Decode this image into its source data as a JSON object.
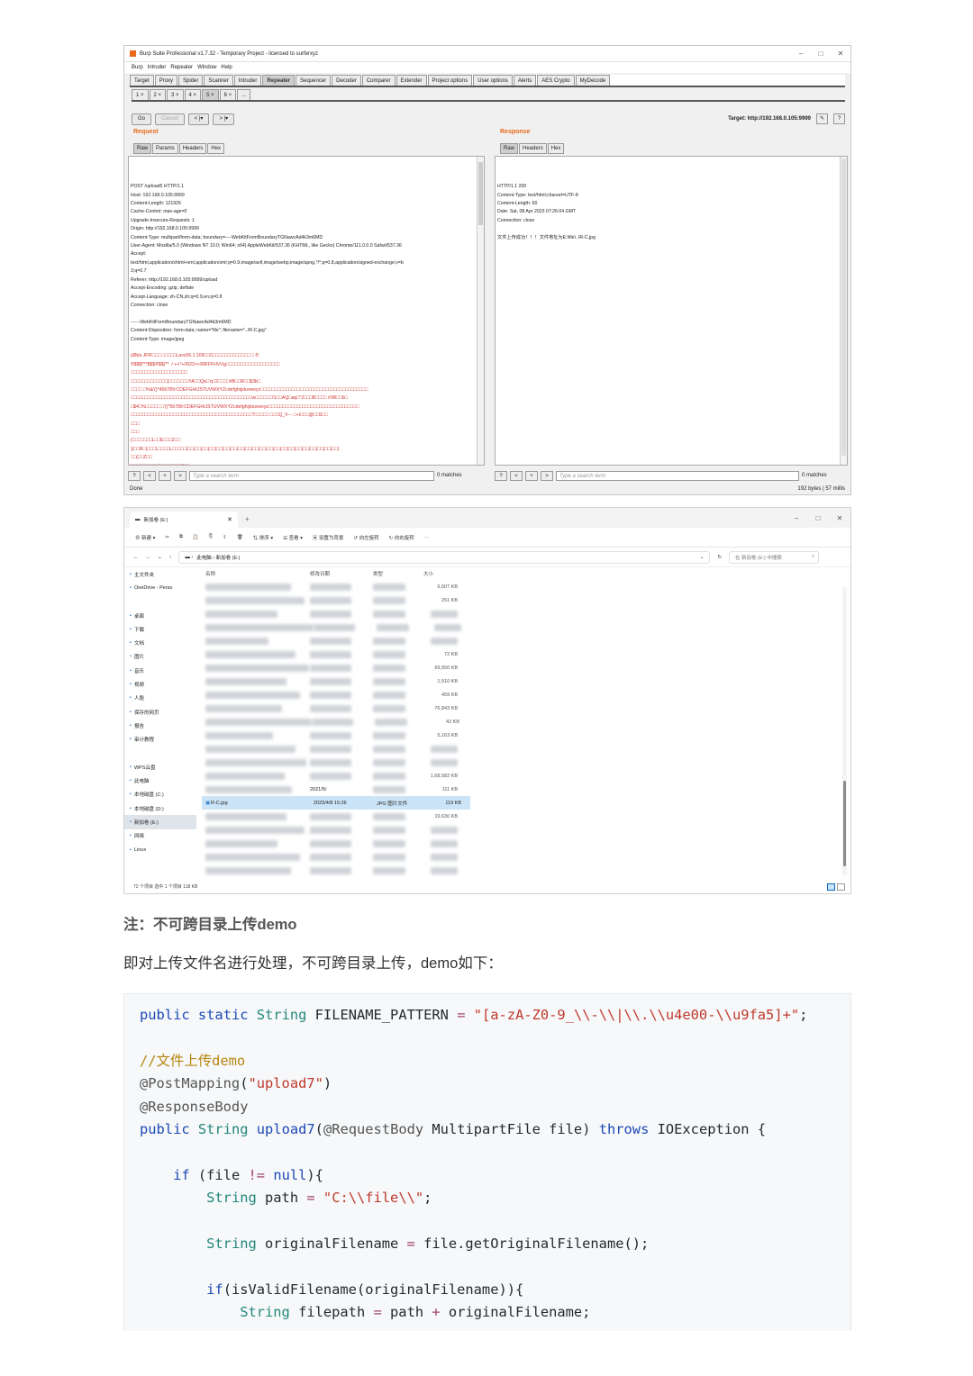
{
  "burp": {
    "title": "Burp Suite Professional v1.7.32 - Temporary Project - licensed to surferxyz",
    "menu": [
      "Burp",
      "Intruder",
      "Repeater",
      "Window",
      "Help"
    ],
    "tabs": [
      "Target",
      "Proxy",
      "Spider",
      "Scanner",
      "Intruder",
      "Repeater",
      "Sequencer",
      "Decoder",
      "Comparer",
      "Extender",
      "Project options",
      "User options",
      "Alerts",
      "AES Crypto",
      "MyDecode"
    ],
    "active_tab": "Repeater",
    "subtabs": [
      "1 ×",
      "2 ×",
      "3 ×",
      "4 ×",
      "5 ×",
      "6 ×",
      "..."
    ],
    "go": "Go",
    "cancel": "Cancel",
    "back": "< |▾",
    "fwd": "> |▾",
    "target": "Target: http://192.168.0.105:9999",
    "request_title": "Request",
    "request_tabs": [
      "Raw",
      "Params",
      "Headers",
      "Hex"
    ],
    "request_lines": [
      "POST /upload5 HTTP/1.1",
      "Host: 192.168.0.105:9999",
      "Content-Length: 121926",
      "Cache-Control: max-age=0",
      "Upgrade-Insecure-Requests: 1",
      "Origin: http://192.168.0.105:9999",
      "Content-Type: multipart/form-data; boundary=----WebKitFormBoundaryTGNawcAd4k3m6MD",
      "User-Agent: Mozilla/5.0 (Windows NT 10.0; Win64; x64) AppleWebKit/537.36 (KHTML, like Gecko) Chrome/111.0.0.0 Safari/537.36",
      "Accept:",
      "text/html,application/xhtml+xml,application/xml;q=0.9,image/avif,image/webp,image/apng,*/*;q=0.8,application/signed-exchange;v=b",
      "3;q=0.7",
      "Referer: http://192.168.0.105:9999/upload",
      "Accept-Encoding: gzip, deflate",
      "Accept-Language: zh-CN,zh;q=0.9,en;q=0.8",
      "Connection: close",
      "",
      "------WebKitFormBoundaryTGNawcAd4k3m6MD",
      "Content-Disposition: form-data; name=\"file\"; filename=\"../R-C.jpg\"",
      "Content-Type: image/jpeg",
      ""
    ],
    "request_binary": [
      "ÿØÿà JFIF□□□ □□□□□Lavc56.1.100□□C□□□□□□□□□□□□□ □ ®",
      "®$$$***$$$®$$(**  / ++*+//022<<99FFFHVVg□□□□□□□□□□□□□□□□□□□",
      "□□□□□□□□□□□□□□□□□□□□",
      "□□□□□□□□□□□□□)□□□□□□□!!A□□Qa□'q□2□□□□#B□□R□□$3b□",
      "□□□□ □%&'()*456789:CDEFGHIJSTUVWXYZcdefghijstuvwxyz□□□□□□□□□□□□□□□□□□□□□□□□□□□□□□□□□□□□□□",
      "□□□□□□□□□□□□□□□□□□□□□□□□□□□□□□□□□□□□□□□□□□□w□□□□□□!1□□AQ□aq□\"2□□□B□□□□ #3R□□b□",
      "□$4□%□□□□□ □'()*56789:CDEFGHIJSTUVWXYZcdefghijstuvwxyz□□□□□□□□□□□□□□□□□□□□□□□□□□□□□□□□",
      "□□□□□□□□□□□□□□□□□□□□□□□□□□□□□□□□□□□□□□□□□□□?□□□□□ □□□Q_V--- □÷t□□□@□□5□□",
      "□□□",
      "□□□",
      "(□□□□□□□L□□E□□□Z□□",
      ")(□□R□(□□□L□□□□L□□□□□(□□(□□(□□(□□(□□(□□(□□(□□(□□(□□(□□(□□(□□(□□(□□(□□(□□(□□(□□(□□(□□(",
      "□□(□□Z□□",
      ")(□□□□□□□□□)□□(□□(□□Z□□",
      ")(□□□□(□□(□□(□□(□□(□□E□□",
      "□□□□E□□□E□□q□□□□E□□",
      "□□□"
    ],
    "response_title": "Response",
    "response_tabs": [
      "Raw",
      "Headers",
      "Hex"
    ],
    "response_lines": [
      "HTTP/1.1 200",
      "Content-Type: text/html;charset=UTF-8",
      "Content-Length: 60",
      "Date: Sat, 08 Apr 2023 07:26:04 GMT",
      "Connection: close",
      ""
    ],
    "response_body": "文件上传成功！！！文件地址为E:\\file\\..\\R-C.jpg",
    "search_placeholder": "Type a search term",
    "matches_left": "0 matches",
    "matches_right": "0 matches",
    "status_left": "Done",
    "status_right": "192 bytes | 57 millis"
  },
  "explorer": {
    "tab_title": "新加卷 (E:)",
    "cmd": [
      "新建",
      "排序",
      "查看",
      "设置为背景",
      "向左旋转",
      "向右旋转",
      "···"
    ],
    "breadcrumb": "此电脑  ›  新加卷 (E:)",
    "search_placeholder": "在 新加卷 (E:) 中搜索",
    "columns": [
      "名称",
      "修改日期",
      "类型",
      "大小"
    ],
    "nav": [
      {
        "label": "主文件夹",
        "icon": "home-icon"
      },
      {
        "label": "OneDrive - Perso",
        "icon": "cloud-icon"
      },
      {
        "label": "",
        "icon": ""
      },
      {
        "label": "桌面",
        "icon": "desktop-icon"
      },
      {
        "label": "下载",
        "icon": "download-icon"
      },
      {
        "label": "文档",
        "icon": "document-icon"
      },
      {
        "label": "图片",
        "icon": "picture-icon"
      },
      {
        "label": "音乐",
        "icon": "music-icon"
      },
      {
        "label": "视频",
        "icon": "video-icon"
      },
      {
        "label": "人脸",
        "icon": "folder-icon"
      },
      {
        "label": "保存的网页",
        "icon": "folder-icon"
      },
      {
        "label": "报告",
        "icon": "folder-icon"
      },
      {
        "label": "审计教程",
        "icon": "folder-icon"
      },
      {
        "label": "",
        "icon": ""
      },
      {
        "label": "WPS云盘",
        "icon": "cloud-icon"
      },
      {
        "label": "此电脑",
        "icon": "pc-icon"
      },
      {
        "label": "本地磁盘 (C:)",
        "icon": "drive-icon"
      },
      {
        "label": "本地磁盘 (D:)",
        "icon": "drive-icon"
      },
      {
        "label": "新加卷 (E:)",
        "icon": "drive-icon"
      },
      {
        "label": "网络",
        "icon": "network-icon"
      },
      {
        "label": "Linux",
        "icon": "linux-icon"
      }
    ],
    "sizes": [
      "6,507 KB",
      "251 KB",
      "",
      "",
      "",
      "72 KB",
      "69,550 KB",
      "1,510 KB",
      "459 KB",
      "76,843 KB",
      "42 KB",
      "5,163 KB",
      "",
      "",
      "1,68,582 KB",
      "111 KB",
      "119 KB",
      "19,630 KB",
      "",
      "",
      "",
      ""
    ],
    "highlight_row": {
      "name": "R-C.jpg",
      "date": "2023/4/8 15:26",
      "type": "JPG 图片文件",
      "size": "119 KB"
    },
    "row_2021": "2021/5/",
    "status": "72 个项目    选中 1 个项目  118 KB"
  },
  "note": "注：不可跨目录上传demo",
  "paragraph": "即对上传文件名进行处理，不可跨目录上传，demo如下：",
  "code_lines": [
    "public static String FILENAME_PATTERN = \"[a-zA-Z0-9_\\\\-\\\\|\\\\.\\\\u4e00-\\\\u9fa5]+\";",
    "",
    "//文件上传demo",
    "@PostMapping(\"upload7\")",
    "@ResponseBody",
    "public String upload7(@RequestBody MultipartFile file) throws IOException {",
    "",
    "    if (file != null){",
    "        String path = \"C:\\\\file\\\\\";",
    "",
    "        String originalFilename = file.getOriginalFilename();",
    "",
    "        if(isValidFilename(originalFilename)){",
    "            String filepath = path + originalFilename;"
  ]
}
